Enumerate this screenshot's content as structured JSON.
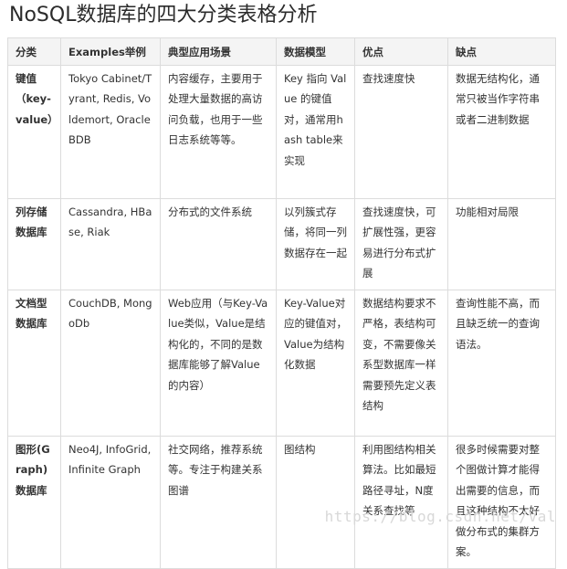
{
  "title": "NoSQL数据库的四大分类表格分析",
  "headers": [
    "分类",
    "Examples举例",
    "典型应用场景",
    "数据模型",
    "优点",
    "缺点"
  ],
  "rows": [
    {
      "category": "键值（key-value）",
      "examples": "Tokyo Cabinet/Tyrant, Redis, Voldemort, Oracle BDB",
      "scenario": "内容缓存，主要用于处理大量数据的高访问负载，也用于一些日志系统等等。",
      "model": "Key 指向 Value 的键值对，通常用hash table来实现",
      "pros": "查找速度快",
      "cons": "数据无结构化，通常只被当作字符串或者二进制数据"
    },
    {
      "category": "列存储数据库",
      "examples": "Cassandra, HBase, Riak",
      "scenario": "分布式的文件系统",
      "model": "以列簇式存储，将同一列数据存在一起",
      "pros": "查找速度快，可扩展性强，更容易进行分布式扩展",
      "cons": "功能相对局限"
    },
    {
      "category": "文档型数据库",
      "examples": "CouchDB, MongoDb",
      "scenario": "Web应用（与Key-Value类似，Value是结构化的，不同的是数据库能够了解Value的内容）",
      "model": "Key-Value对应的键值对，Value为结构化数据",
      "pros": "数据结构要求不严格，表结构可变，不需要像关系型数据库一样需要预先定义表结构",
      "cons": "查询性能不高，而且缺乏统一的查询语法。"
    },
    {
      "category": "图形(Graph)数据库",
      "examples": "Neo4J, InfoGrid, Infinite Graph",
      "scenario": "社交网络，推荐系统等。专注于构建关系图谱",
      "model": "图结构",
      "pros": "利用图结构相关算法。比如最短路径寻址，N度关系查找等",
      "cons": "很多时候需要对整个图做计算才能得出需要的信息，而且这种结构不太好做分布式的集群方案。"
    }
  ],
  "watermark": "https://blog.csdn.net/Val"
}
